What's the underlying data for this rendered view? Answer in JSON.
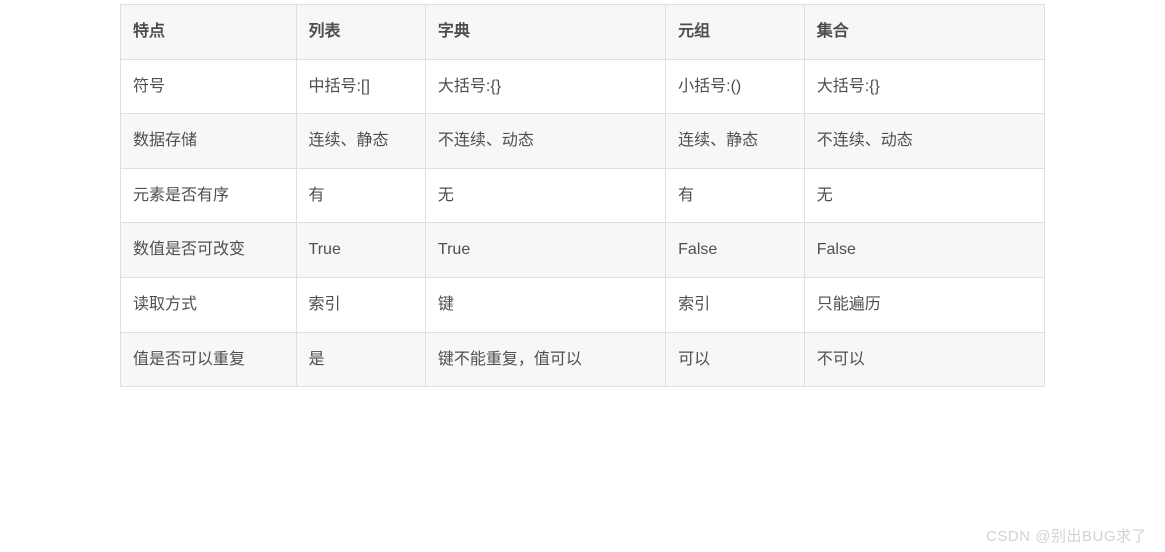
{
  "table": {
    "headers": [
      "特点",
      "列表",
      "字典",
      "元组",
      "集合"
    ],
    "rows": [
      {
        "cells": [
          "符号",
          "中括号:[]",
          "大括号:{}",
          "小括号:()",
          "大括号:{}"
        ]
      },
      {
        "cells": [
          "数据存储",
          "连续、静态",
          "不连续、动态",
          "连续、静态",
          "不连续、动态"
        ]
      },
      {
        "cells": [
          "元素是否有序",
          "有",
          "无",
          "有",
          "无"
        ]
      },
      {
        "cells": [
          "数值是否可改变",
          "True",
          "True",
          "False",
          "False"
        ]
      },
      {
        "cells": [
          "读取方式",
          "索引",
          "键",
          "索引",
          "只能遍历"
        ]
      },
      {
        "cells": [
          "值是否可以重复",
          "是",
          "键不能重复，值可以",
          "可以",
          "不可以"
        ]
      }
    ]
  },
  "watermark": "CSDN @别出BUG求了"
}
